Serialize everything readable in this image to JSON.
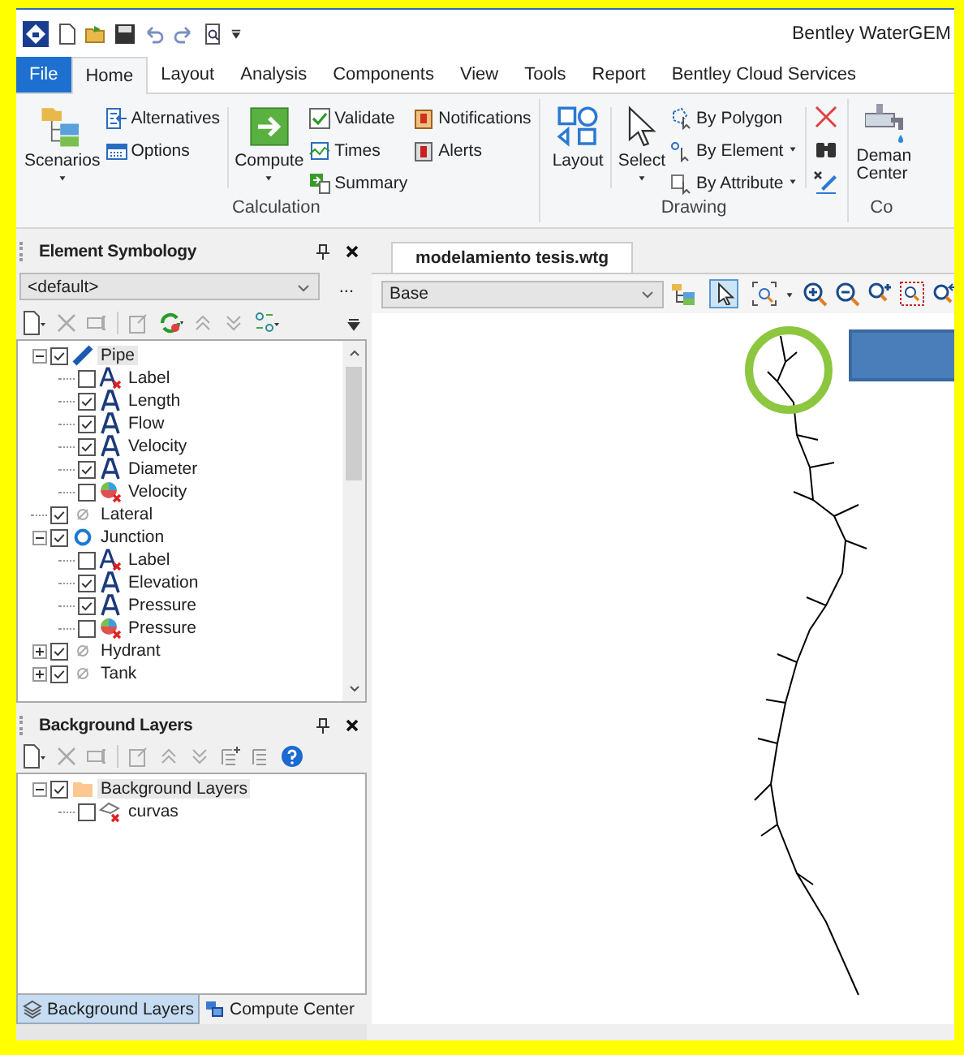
{
  "window": {
    "title": "Bentley WaterGEM"
  },
  "menu_tabs": [
    {
      "label": "File",
      "kind": "file",
      "selected": false
    },
    {
      "label": "Home",
      "kind": "tab",
      "selected": true
    },
    {
      "label": "Layout",
      "kind": "tab",
      "selected": false
    },
    {
      "label": "Analysis",
      "kind": "tab",
      "selected": false
    },
    {
      "label": "Components",
      "kind": "tab",
      "selected": false
    },
    {
      "label": "View",
      "kind": "tab",
      "selected": false
    },
    {
      "label": "Tools",
      "kind": "tab",
      "selected": false
    },
    {
      "label": "Report",
      "kind": "tab",
      "selected": false
    },
    {
      "label": "Bentley Cloud Services",
      "kind": "tab",
      "selected": false
    }
  ],
  "ribbon": {
    "calculation": {
      "label": "Calculation",
      "scenarios": "Scenarios",
      "alternatives": "Alternatives",
      "options": "Options",
      "compute": "Compute",
      "validate": "Validate",
      "times": "Times",
      "summary": "Summary",
      "notifications": "Notifications",
      "alerts": "Alerts"
    },
    "drawing": {
      "label": "Drawing",
      "layout": "Layout",
      "select": "Select",
      "by_polygon": "By Polygon",
      "by_element": "By Element",
      "by_attribute": "By Attribute"
    },
    "group_3": {
      "label": "Co",
      "button": [
        "Deman",
        "Center"
      ]
    }
  },
  "element_symbology": {
    "title": "Element Symbology",
    "dropdown": "<default>",
    "more": "...",
    "tree": [
      {
        "label": "Pipe",
        "kind": "pipe",
        "checked": true,
        "expanded": true,
        "selected": true,
        "children": [
          {
            "label": "Label",
            "kind": "label",
            "checked": false,
            "selected": false
          },
          {
            "label": "Length",
            "kind": "annotation",
            "checked": true,
            "selected": false
          },
          {
            "label": "Flow",
            "kind": "annotation",
            "checked": true,
            "selected": false
          },
          {
            "label": "Velocity",
            "kind": "annotation",
            "checked": true,
            "selected": false
          },
          {
            "label": "Diameter",
            "kind": "annotation",
            "checked": true,
            "selected": false
          },
          {
            "label": "Velocity",
            "kind": "color-coding",
            "checked": false,
            "selected": false
          }
        ]
      },
      {
        "label": "Lateral",
        "kind": "plain",
        "checked": true,
        "selected": false
      },
      {
        "label": "Junction",
        "kind": "junction",
        "checked": true,
        "expanded": true,
        "selected": false,
        "children": [
          {
            "label": "Label",
            "kind": "label",
            "checked": false,
            "selected": false
          },
          {
            "label": "Elevation",
            "kind": "annotation",
            "checked": true,
            "selected": false
          },
          {
            "label": "Pressure",
            "kind": "annotation",
            "checked": true,
            "selected": false
          },
          {
            "label": "Pressure",
            "kind": "color-coding",
            "checked": false,
            "selected": false
          }
        ]
      },
      {
        "label": "Hydrant",
        "kind": "plain",
        "checked": true,
        "expanded": false,
        "selected": false
      },
      {
        "label": "Tank",
        "kind": "plain",
        "checked": true,
        "expanded": false,
        "selected": false
      }
    ]
  },
  "background_layers": {
    "title": "Background Layers",
    "tree": [
      {
        "label": "Background Layers",
        "kind": "folder",
        "checked": true,
        "expanded": true,
        "selected": true,
        "children": [
          {
            "label": "curvas",
            "kind": "layer",
            "checked": false,
            "selected": false
          }
        ]
      }
    ]
  },
  "panel_tabs": [
    {
      "label": "Background Layers",
      "kind": "layers",
      "selected": true
    },
    {
      "label": "Compute Center",
      "kind": "compute",
      "selected": false
    }
  ],
  "document": {
    "tab": "modelamiento tesis.wtg",
    "scenario": "Base"
  }
}
